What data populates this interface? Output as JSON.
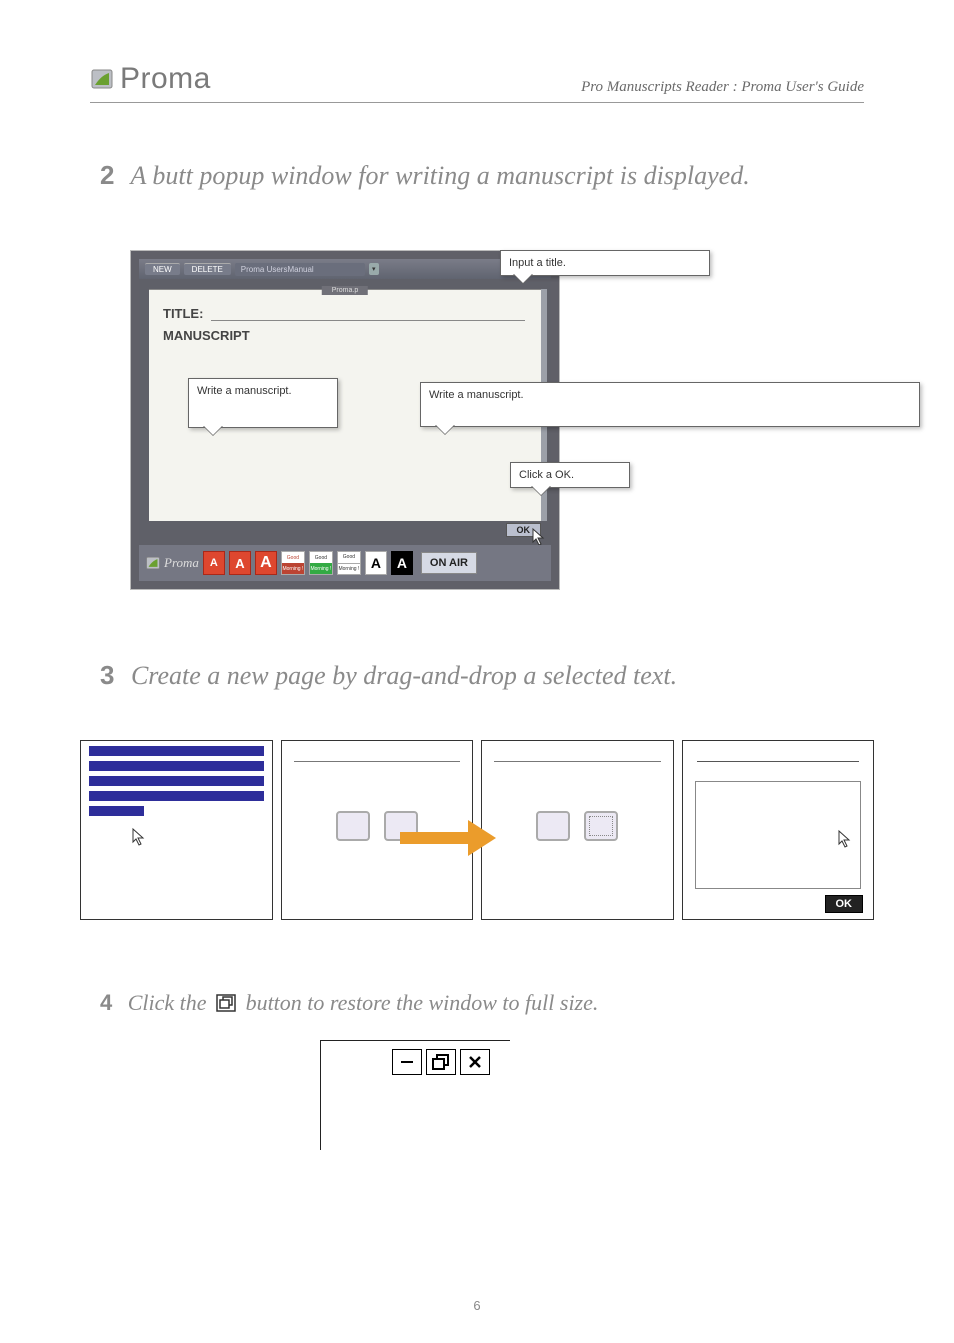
{
  "header": {
    "logo_text": "Proma",
    "right_text": "Pro Manuscripts Reader : Proma User's Guide"
  },
  "section1": {
    "number": "2",
    "title": "A butt popup window for writing a manuscript is displayed."
  },
  "shot1": {
    "top_new": "NEW",
    "top_delete": "DELETE",
    "top_filename": "Proma UsersManual",
    "paper_header": "Proma.p",
    "title_label": "TITLE:",
    "manuscript_label": "MANUSCRIPT",
    "ok_label": "OK",
    "toolbar_logo": "Proma",
    "A": "A",
    "theme_top": "Good",
    "theme_bot": "Morning !",
    "onair": "ON AIR"
  },
  "callouts": {
    "a": "Input a title.",
    "b": "Write a manuscript.",
    "c": "Write a manuscript.",
    "d": "Click a OK."
  },
  "section2": {
    "number": "3",
    "title": "Create a new page by drag-and-drop a selected text."
  },
  "panel4": {
    "ok": "OK"
  },
  "section3": {
    "number": "4",
    "title_a": "Click the ",
    "title_b": " button to restore the window to full size."
  },
  "page_number": "6"
}
